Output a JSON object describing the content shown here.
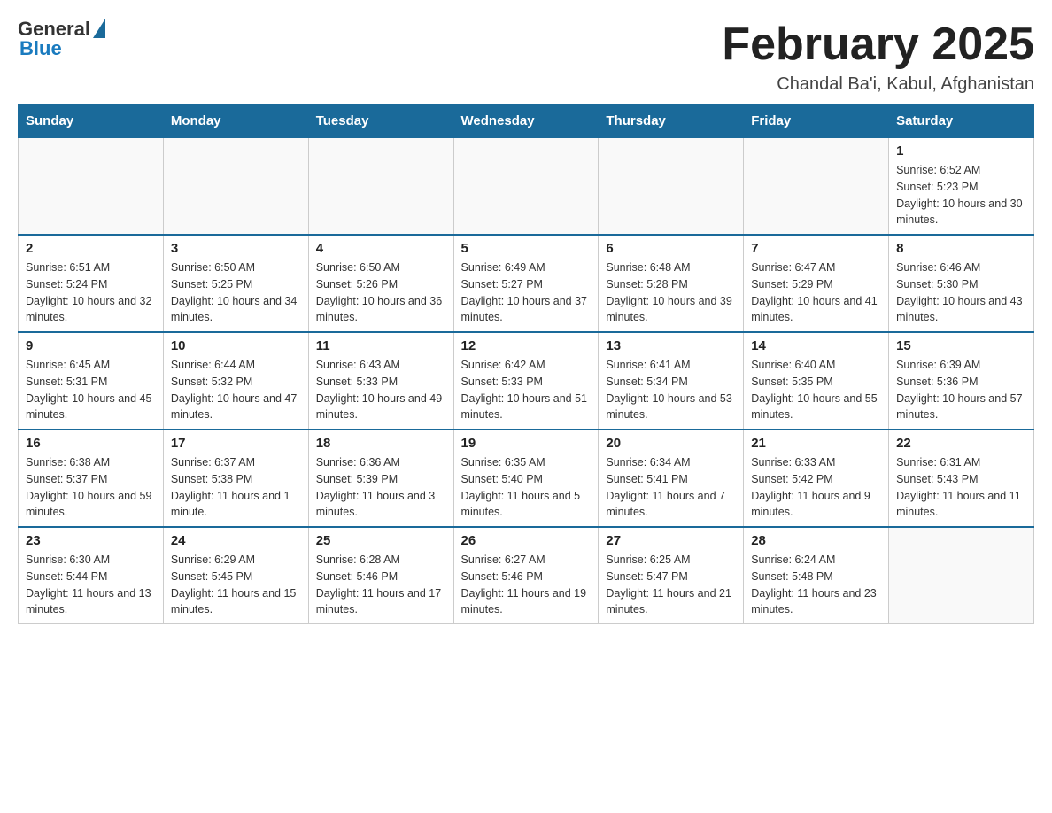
{
  "header": {
    "logo_general": "General",
    "logo_blue": "Blue",
    "month_title": "February 2025",
    "location": "Chandal Ba'i, Kabul, Afghanistan"
  },
  "weekdays": [
    "Sunday",
    "Monday",
    "Tuesday",
    "Wednesday",
    "Thursday",
    "Friday",
    "Saturday"
  ],
  "weeks": [
    [
      {
        "day": "",
        "info": ""
      },
      {
        "day": "",
        "info": ""
      },
      {
        "day": "",
        "info": ""
      },
      {
        "day": "",
        "info": ""
      },
      {
        "day": "",
        "info": ""
      },
      {
        "day": "",
        "info": ""
      },
      {
        "day": "1",
        "info": "Sunrise: 6:52 AM\nSunset: 5:23 PM\nDaylight: 10 hours and 30 minutes."
      }
    ],
    [
      {
        "day": "2",
        "info": "Sunrise: 6:51 AM\nSunset: 5:24 PM\nDaylight: 10 hours and 32 minutes."
      },
      {
        "day": "3",
        "info": "Sunrise: 6:50 AM\nSunset: 5:25 PM\nDaylight: 10 hours and 34 minutes."
      },
      {
        "day": "4",
        "info": "Sunrise: 6:50 AM\nSunset: 5:26 PM\nDaylight: 10 hours and 36 minutes."
      },
      {
        "day": "5",
        "info": "Sunrise: 6:49 AM\nSunset: 5:27 PM\nDaylight: 10 hours and 37 minutes."
      },
      {
        "day": "6",
        "info": "Sunrise: 6:48 AM\nSunset: 5:28 PM\nDaylight: 10 hours and 39 minutes."
      },
      {
        "day": "7",
        "info": "Sunrise: 6:47 AM\nSunset: 5:29 PM\nDaylight: 10 hours and 41 minutes."
      },
      {
        "day": "8",
        "info": "Sunrise: 6:46 AM\nSunset: 5:30 PM\nDaylight: 10 hours and 43 minutes."
      }
    ],
    [
      {
        "day": "9",
        "info": "Sunrise: 6:45 AM\nSunset: 5:31 PM\nDaylight: 10 hours and 45 minutes."
      },
      {
        "day": "10",
        "info": "Sunrise: 6:44 AM\nSunset: 5:32 PM\nDaylight: 10 hours and 47 minutes."
      },
      {
        "day": "11",
        "info": "Sunrise: 6:43 AM\nSunset: 5:33 PM\nDaylight: 10 hours and 49 minutes."
      },
      {
        "day": "12",
        "info": "Sunrise: 6:42 AM\nSunset: 5:33 PM\nDaylight: 10 hours and 51 minutes."
      },
      {
        "day": "13",
        "info": "Sunrise: 6:41 AM\nSunset: 5:34 PM\nDaylight: 10 hours and 53 minutes."
      },
      {
        "day": "14",
        "info": "Sunrise: 6:40 AM\nSunset: 5:35 PM\nDaylight: 10 hours and 55 minutes."
      },
      {
        "day": "15",
        "info": "Sunrise: 6:39 AM\nSunset: 5:36 PM\nDaylight: 10 hours and 57 minutes."
      }
    ],
    [
      {
        "day": "16",
        "info": "Sunrise: 6:38 AM\nSunset: 5:37 PM\nDaylight: 10 hours and 59 minutes."
      },
      {
        "day": "17",
        "info": "Sunrise: 6:37 AM\nSunset: 5:38 PM\nDaylight: 11 hours and 1 minute."
      },
      {
        "day": "18",
        "info": "Sunrise: 6:36 AM\nSunset: 5:39 PM\nDaylight: 11 hours and 3 minutes."
      },
      {
        "day": "19",
        "info": "Sunrise: 6:35 AM\nSunset: 5:40 PM\nDaylight: 11 hours and 5 minutes."
      },
      {
        "day": "20",
        "info": "Sunrise: 6:34 AM\nSunset: 5:41 PM\nDaylight: 11 hours and 7 minutes."
      },
      {
        "day": "21",
        "info": "Sunrise: 6:33 AM\nSunset: 5:42 PM\nDaylight: 11 hours and 9 minutes."
      },
      {
        "day": "22",
        "info": "Sunrise: 6:31 AM\nSunset: 5:43 PM\nDaylight: 11 hours and 11 minutes."
      }
    ],
    [
      {
        "day": "23",
        "info": "Sunrise: 6:30 AM\nSunset: 5:44 PM\nDaylight: 11 hours and 13 minutes."
      },
      {
        "day": "24",
        "info": "Sunrise: 6:29 AM\nSunset: 5:45 PM\nDaylight: 11 hours and 15 minutes."
      },
      {
        "day": "25",
        "info": "Sunrise: 6:28 AM\nSunset: 5:46 PM\nDaylight: 11 hours and 17 minutes."
      },
      {
        "day": "26",
        "info": "Sunrise: 6:27 AM\nSunset: 5:46 PM\nDaylight: 11 hours and 19 minutes."
      },
      {
        "day": "27",
        "info": "Sunrise: 6:25 AM\nSunset: 5:47 PM\nDaylight: 11 hours and 21 minutes."
      },
      {
        "day": "28",
        "info": "Sunrise: 6:24 AM\nSunset: 5:48 PM\nDaylight: 11 hours and 23 minutes."
      },
      {
        "day": "",
        "info": ""
      }
    ]
  ]
}
